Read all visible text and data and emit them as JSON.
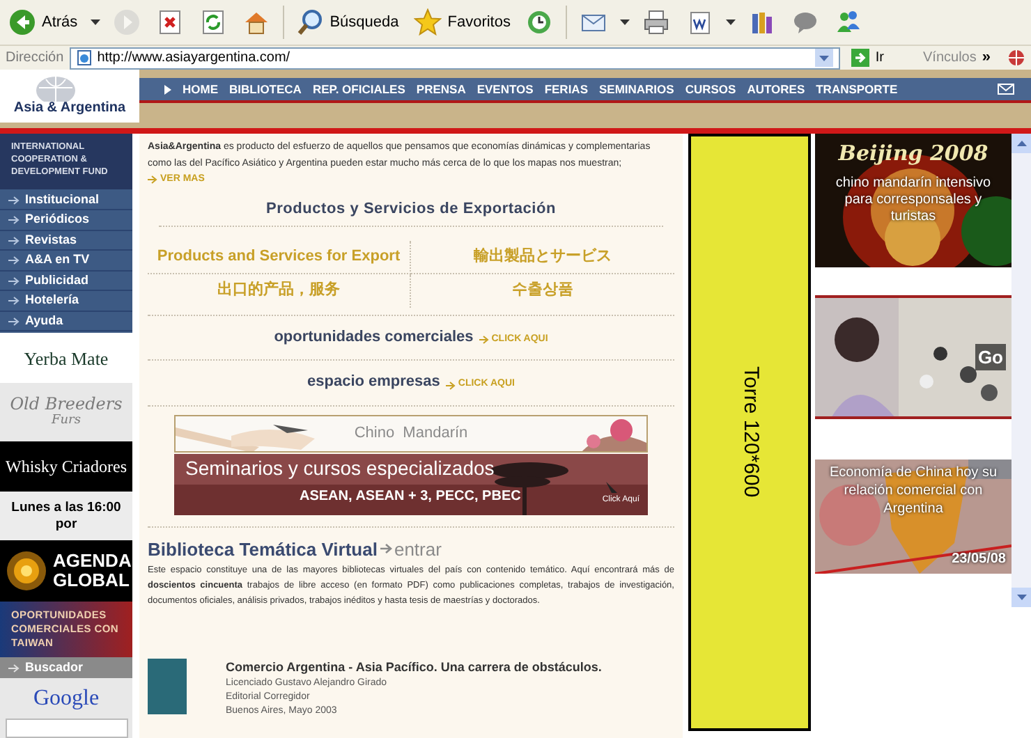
{
  "toolbar": [
    {
      "kind": "back",
      "label": "Atrás",
      "disabled": false
    },
    {
      "kind": "forward",
      "disabled": true
    },
    {
      "kind": "stop",
      "disabled": false
    },
    {
      "kind": "refresh",
      "disabled": false
    },
    {
      "kind": "home",
      "disabled": false
    },
    {
      "kind": "search",
      "label": "Búsqueda",
      "disabled": false
    },
    {
      "kind": "favorites",
      "label": "Favoritos",
      "disabled": false
    },
    {
      "kind": "history",
      "disabled": false
    },
    {
      "kind": "mail",
      "disabled": false
    },
    {
      "kind": "print",
      "disabled": false
    },
    {
      "kind": "edit",
      "disabled": false
    },
    {
      "kind": "research",
      "disabled": false
    },
    {
      "kind": "discuss",
      "disabled": false
    },
    {
      "kind": "messenger",
      "disabled": false
    }
  ],
  "address_bar": {
    "label": "Dirección",
    "url": "http://www.asiayargentina.com/",
    "go": "Ir",
    "links": "Vínculos",
    "more": "»"
  },
  "site": {
    "logo": "Asia & Argentina",
    "nav": [
      "HOME",
      "BIBLIOTECA",
      "REP. OFICIALES",
      "PRENSA",
      "EVENTOS",
      "FERIAS",
      "SEMINARIOS",
      "CURSOS",
      "AUTORES",
      "TRANSPORTE"
    ]
  },
  "sidebar": {
    "title": "INTERNATIONAL COOPERATION & DEVELOPMENT FUND",
    "items": [
      "Institucional",
      "Periódicos",
      "Revistas",
      "A&A en TV",
      "Publicidad",
      "Hotelería",
      "Ayuda"
    ],
    "ads": [
      {
        "kind": "yerba",
        "text": "Yerba Mate"
      },
      {
        "kind": "breeders",
        "text": "Old Breeders",
        "sub": "Furs"
      },
      {
        "kind": "whisky",
        "text": "Whisky Criadores"
      },
      {
        "kind": "lunes",
        "text": "Lunes a las 16:00 por"
      },
      {
        "kind": "agenda",
        "text": "AGENDA GLOBAL"
      },
      {
        "kind": "taiwan",
        "text": "OPORTUNIDADES COMERCIALES CON TAIWAN"
      }
    ],
    "search_label": "Buscador",
    "search_engine": "Google"
  },
  "main": {
    "intro": "**Asia&Argentina** es producto del esfuerzo de aquellos que pensamos que economías dinámicas y complementarias como las del Pacífico Asiático y Argentina pueden estar mucho más cerca de lo que los mapas nos muestran;",
    "more": "VER MAS",
    "heading": "Productos y Servicios de Exportación",
    "languages": [
      "Products and Services for Export",
      "輸出製品とサービス",
      "出口的产品，服务",
      "수출상품"
    ],
    "links": [
      {
        "text": "oportunidades comerciales",
        "action": "CLICK AQUI"
      },
      {
        "text": "espacio empresas",
        "action": "CLICK AQUI"
      }
    ],
    "banner_1": "Chino  Mandarín",
    "banner_2": {
      "title": "Seminarios y cursos especializados",
      "subtitle": "ASEAN, ASEAN + 3, PECC, PBEC",
      "action": "Click Aquí"
    },
    "library": {
      "title": "Biblioteca Temática Virtual",
      "action": "entrar",
      "text": "Este espacio constituye una de las mayores bibliotecas virtuales del país con contenido temático. Aquí encontrará más de **doscientos cincuenta** trabajos de libre acceso (en formato PDF) como publicaciones completas, trabajos de investigación, documentos oficiales, análisis privados, trabajos inéditos y hasta tesis de maestrías y doctorados."
    },
    "book": {
      "title": "Comercio Argentina - Asia Pacífico. Una carrera de obstáculos.",
      "lines": [
        "Licenciado Gustavo Alejandro Girado",
        "Editorial Corregidor",
        "Buenos Aires, Mayo 2003"
      ]
    }
  },
  "tower": "Torre 120*600",
  "ads": [
    {
      "kind": "beijing",
      "title": "Beijing 2008",
      "text": "chino mandarín intensivo para corresponsales y turistas"
    },
    {
      "kind": "go",
      "text": "Go"
    },
    {
      "kind": "economia",
      "text": "Economía de China hoy su relación comercial con Argentina",
      "date": "23/05/08"
    }
  ]
}
